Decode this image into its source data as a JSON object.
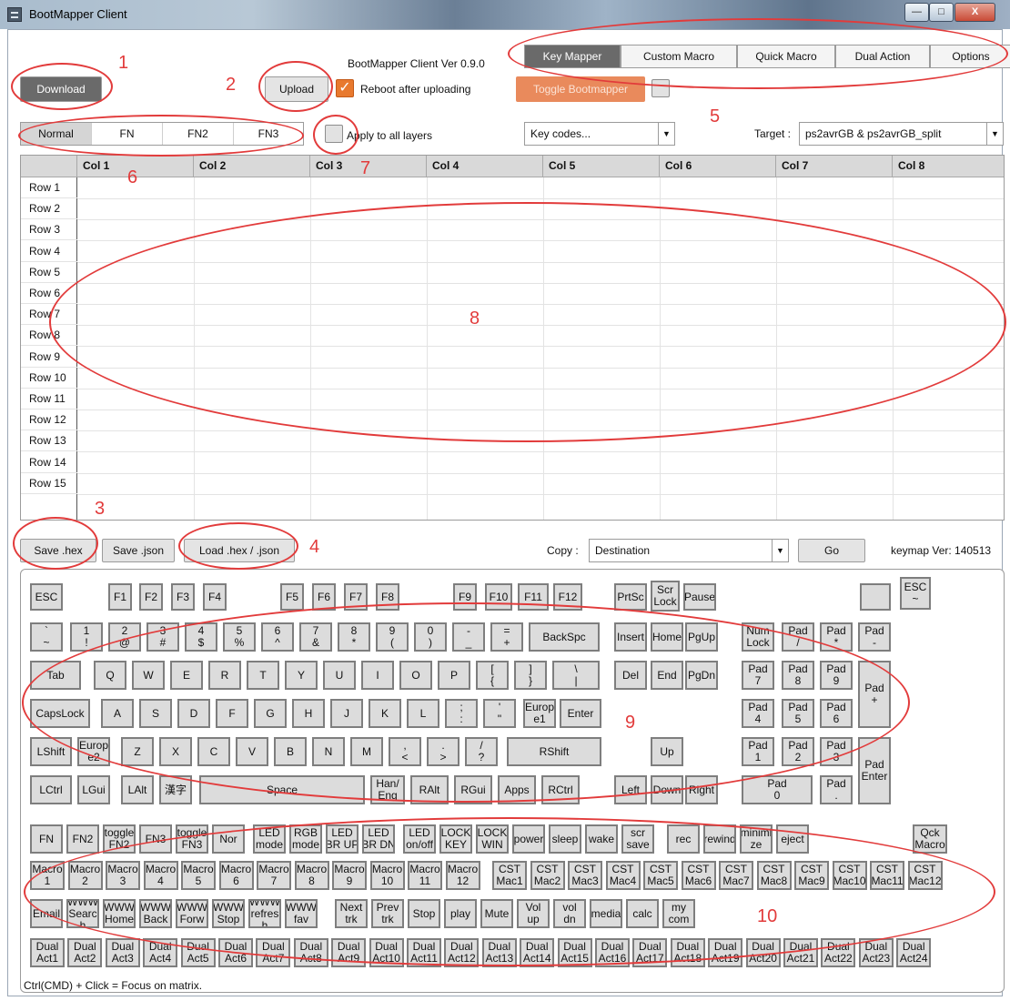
{
  "window": {
    "title": "BootMapper Client",
    "min_glyph": "—",
    "max_glyph": "□",
    "close_glyph": "X"
  },
  "header": {
    "version": "BootMapper Client Ver 0.9.0",
    "download": "Download",
    "upload": "Upload",
    "reboot_label": "Reboot after uploading",
    "reboot_checked": true,
    "toggle_bootmapper": "Toggle Bootmapper",
    "tabs": [
      "Key Mapper",
      "Custom Macro",
      "Quick Macro",
      "Dual Action",
      "Options"
    ],
    "active_tab": "Key Mapper"
  },
  "layers": {
    "items": [
      "Normal",
      "FN",
      "FN2",
      "FN3"
    ],
    "active": "Normal",
    "apply_all_label": "Apply to all layers",
    "keycodes_value": "Key codes...",
    "target_label": "Target :",
    "target_value": "ps2avrGB & ps2avrGB_split"
  },
  "matrix": {
    "columns": [
      "Col 1",
      "Col 2",
      "Col 3",
      "Col 4",
      "Col 5",
      "Col 6",
      "Col 7",
      "Col 8"
    ],
    "rows": [
      "Row 1",
      "Row 2",
      "Row 3",
      "Row 4",
      "Row 5",
      "Row 6",
      "Row 7",
      "Row 8",
      "Row 9",
      "Row 10",
      "Row 11",
      "Row 12",
      "Row 13",
      "Row 14",
      "Row 15"
    ]
  },
  "file_bar": {
    "save_hex": "Save .hex",
    "save_json": "Save .json",
    "load": "Load .hex / .json",
    "copy_label": "Copy :",
    "copy_value": "Destination",
    "go": "Go",
    "keymap_ver": "keymap Ver: 140513"
  },
  "keyboard": {
    "keys": [
      [
        "ESC"
      ],
      [
        "F1"
      ],
      [
        "F2"
      ],
      [
        "F3"
      ],
      [
        "F4"
      ],
      [
        "F5"
      ],
      [
        "F6"
      ],
      [
        "F7"
      ],
      [
        "F8"
      ],
      [
        "F9"
      ],
      [
        "F10"
      ],
      [
        "F11"
      ],
      [
        "F12"
      ],
      [
        "PrtSc"
      ],
      [
        "Scr\nLock"
      ],
      [
        "Pause"
      ],
      [
        ""
      ],
      [
        "ESC\n~"
      ],
      [
        "`\n~"
      ],
      [
        "1\n!"
      ],
      [
        "2\n@"
      ],
      [
        "3\n#"
      ],
      [
        "4\n$"
      ],
      [
        "5\n%"
      ],
      [
        "6\n^"
      ],
      [
        "7\n&"
      ],
      [
        "8\n*"
      ],
      [
        "9\n("
      ],
      [
        "0\n)"
      ],
      [
        "-\n_"
      ],
      [
        "=\n+"
      ],
      [
        "BackSpc"
      ],
      [
        "Insert"
      ],
      [
        "Home"
      ],
      [
        "PgUp"
      ],
      [
        "Num\nLock"
      ],
      [
        "Pad\n/"
      ],
      [
        "Pad\n*"
      ],
      [
        "Pad\n-"
      ],
      [
        "Tab"
      ],
      [
        "Q"
      ],
      [
        "W"
      ],
      [
        "E"
      ],
      [
        "R"
      ],
      [
        "T"
      ],
      [
        "Y"
      ],
      [
        "U"
      ],
      [
        "I"
      ],
      [
        "O"
      ],
      [
        "P"
      ],
      [
        "[\n{"
      ],
      [
        "]\n}"
      ],
      [
        "\\\n|"
      ],
      [
        "Del"
      ],
      [
        "End"
      ],
      [
        "PgDn"
      ],
      [
        "Pad\n7"
      ],
      [
        "Pad\n8"
      ],
      [
        "Pad\n9"
      ],
      [
        "Pad\n+"
      ],
      [
        "CapsLock"
      ],
      [
        "A"
      ],
      [
        "S"
      ],
      [
        "D"
      ],
      [
        "F"
      ],
      [
        "G"
      ],
      [
        "H"
      ],
      [
        "J"
      ],
      [
        "K"
      ],
      [
        "L"
      ],
      [
        ";\n:"
      ],
      [
        "'\n\""
      ],
      [
        "Europ\ne1"
      ],
      [
        "Enter"
      ],
      [
        "Pad\n4"
      ],
      [
        "Pad\n5"
      ],
      [
        "Pad\n6"
      ],
      [
        "LShift"
      ],
      [
        "Europ\ne2"
      ],
      [
        "Z"
      ],
      [
        "X"
      ],
      [
        "C"
      ],
      [
        "V"
      ],
      [
        "B"
      ],
      [
        "N"
      ],
      [
        "M"
      ],
      [
        ",\n<"
      ],
      [
        ".\n>"
      ],
      [
        "/\n?"
      ],
      [
        "RShift"
      ],
      [
        "Up"
      ],
      [
        "Pad\n1"
      ],
      [
        "Pad\n2"
      ],
      [
        "Pad\n3"
      ],
      [
        "Pad\nEnter"
      ],
      [
        "LCtrl"
      ],
      [
        "LGui"
      ],
      [
        "LAlt"
      ],
      [
        "漢字"
      ],
      [
        "Space"
      ],
      [
        "Han/\nEng"
      ],
      [
        "RAlt"
      ],
      [
        "RGui"
      ],
      [
        "Apps"
      ],
      [
        "RCtrl"
      ],
      [
        "Left"
      ],
      [
        "Down"
      ],
      [
        "Right"
      ],
      [
        "Pad\n0"
      ],
      [
        "Pad\n."
      ],
      [
        "FN"
      ],
      [
        "FN2"
      ],
      [
        "toggle\nFN2"
      ],
      [
        "FN3"
      ],
      [
        "toggle\nFN3"
      ],
      [
        "Nor"
      ],
      [
        "LED\nmode"
      ],
      [
        "RGB\nmode"
      ],
      [
        "LED\nBR UP"
      ],
      [
        "LED\nBR DN"
      ],
      [
        "LED\non/off"
      ],
      [
        "LOCK\nKEY"
      ],
      [
        "LOCK\nWIN"
      ],
      [
        "power"
      ],
      [
        "sleep"
      ],
      [
        "wake"
      ],
      [
        "scr\nsave"
      ],
      [
        "rec"
      ],
      [
        "rewind"
      ],
      [
        "minimi\nze"
      ],
      [
        "eject"
      ],
      [
        "Qck\nMacro"
      ],
      [
        "Macro\n1"
      ],
      [
        "Macro\n2"
      ],
      [
        "Macro\n3"
      ],
      [
        "Macro\n4"
      ],
      [
        "Macro\n5"
      ],
      [
        "Macro\n6"
      ],
      [
        "Macro\n7"
      ],
      [
        "Macro\n8"
      ],
      [
        "Macro\n9"
      ],
      [
        "Macro\n10"
      ],
      [
        "Macro\n11"
      ],
      [
        "Macro\n12"
      ],
      [
        "CST\nMac1"
      ],
      [
        "CST\nMac2"
      ],
      [
        "CST\nMac3"
      ],
      [
        "CST\nMac4"
      ],
      [
        "CST\nMac5"
      ],
      [
        "CST\nMac6"
      ],
      [
        "CST\nMac7"
      ],
      [
        "CST\nMac8"
      ],
      [
        "CST\nMac9"
      ],
      [
        "CST\nMac10"
      ],
      [
        "CST\nMac11"
      ],
      [
        "CST\nMac12"
      ],
      [
        "Email"
      ],
      [
        "WWW\nSearc\nh"
      ],
      [
        "WWW\nHome"
      ],
      [
        "WWW\nBack"
      ],
      [
        "WWW\nForw"
      ],
      [
        "WWW\nStop"
      ],
      [
        "WWW\nrefres\nh"
      ],
      [
        "WWW\nfav"
      ],
      [
        "Next\ntrk"
      ],
      [
        "Prev\ntrk"
      ],
      [
        "Stop"
      ],
      [
        "play"
      ],
      [
        "Mute"
      ],
      [
        "Vol\nup"
      ],
      [
        "vol\ndn"
      ],
      [
        "media"
      ],
      [
        "calc"
      ],
      [
        "my\ncom"
      ],
      [
        "Dual\nAct1"
      ],
      [
        "Dual\nAct2"
      ],
      [
        "Dual\nAct3"
      ],
      [
        "Dual\nAct4"
      ],
      [
        "Dual\nAct5"
      ],
      [
        "Dual\nAct6"
      ],
      [
        "Dual\nAct7"
      ],
      [
        "Dual\nAct8"
      ],
      [
        "Dual\nAct9"
      ],
      [
        "Dual\nAct10"
      ],
      [
        "Dual\nAct11"
      ],
      [
        "Dual\nAct12"
      ],
      [
        "Dual\nAct13"
      ],
      [
        "Dual\nAct14"
      ],
      [
        "Dual\nAct15"
      ],
      [
        "Dual\nAct16"
      ],
      [
        "Dual\nAct17"
      ],
      [
        "Dual\nAct18"
      ],
      [
        "Dual\nAct19"
      ],
      [
        "Dual\nAct20"
      ],
      [
        "Dual\nAct21"
      ],
      [
        "Dual\nAct22"
      ],
      [
        "Dual\nAct23"
      ],
      [
        "Dual\nAct24"
      ]
    ],
    "hint": "Ctrl(CMD) + Click = Focus on matrix."
  },
  "annotations": {
    "numbers": [
      "1",
      "2",
      "3",
      "4",
      "5",
      "6",
      "7",
      "8",
      "9",
      "10"
    ],
    "color": "#e23b3b"
  }
}
